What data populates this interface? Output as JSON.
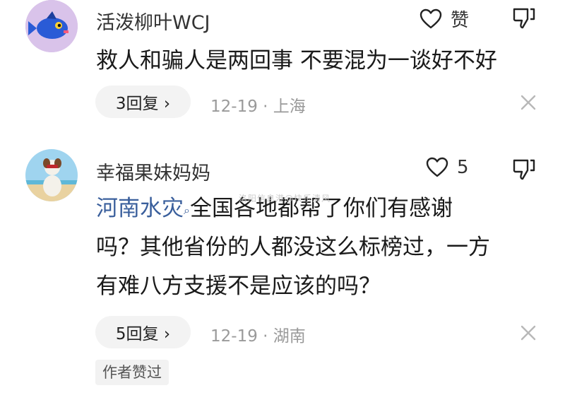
{
  "comments": [
    {
      "username": "活泼柳叶WCJ",
      "like_label": "赞",
      "lines": [
        "救人和骗人是两回事 不要混为一谈好不好"
      ],
      "reply_label": "3回复 ›",
      "meta": "12-19 · 上海"
    },
    {
      "username": "幸福果妹妈妈",
      "like_label": "5",
      "tag": "河南水灾",
      "lines": [
        "全国各地都帮了你们有感谢",
        "吗？其他省份的人都没这么标榜过，一方",
        "有难八方支援不是应该的吗？"
      ],
      "reply_label": "5回复 ›",
      "meta": "12-19 · 湖南",
      "author_badge": "作者赞过"
    }
  ],
  "watermark": "洛阳信息港@快乐清风"
}
